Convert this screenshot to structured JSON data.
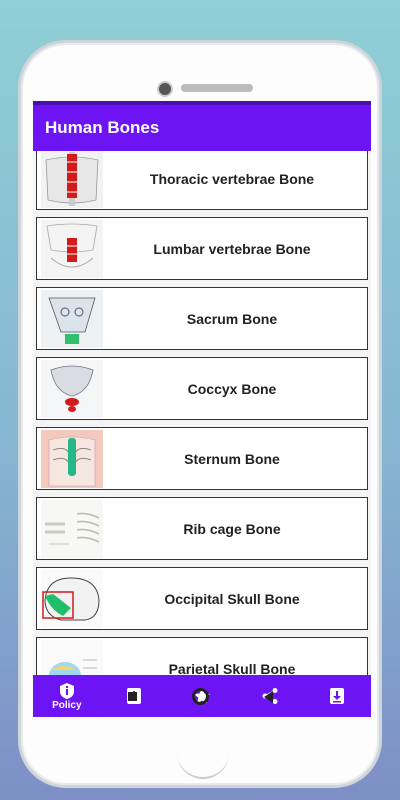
{
  "app": {
    "title": "Human Bones"
  },
  "list": {
    "items": [
      {
        "label": "Thoracic vertebrae Bone",
        "thumb": "thoracic-spine-image"
      },
      {
        "label": "Lumbar vertebrae Bone",
        "thumb": "lumbar-spine-image"
      },
      {
        "label": "Sacrum Bone",
        "thumb": "sacrum-image"
      },
      {
        "label": "Coccyx Bone",
        "thumb": "coccyx-image"
      },
      {
        "label": "Sternum Bone",
        "thumb": "sternum-image"
      },
      {
        "label": "Rib cage Bone",
        "thumb": "rib-cage-image"
      },
      {
        "label": "Occipital Skull Bone",
        "thumb": "occipital-skull-image"
      },
      {
        "label": "Parietal Skull Bone",
        "thumb": "parietal-skull-image"
      }
    ]
  },
  "bottom_nav": {
    "policy_label": "Policy",
    "icons": [
      "info-shield-icon",
      "info-card-icon",
      "star-icon",
      "share-icon",
      "download-icon"
    ]
  },
  "colors": {
    "primary": "#6d14f5",
    "accent_red": "#d21b1b",
    "accent_green": "#1fbf6a"
  }
}
